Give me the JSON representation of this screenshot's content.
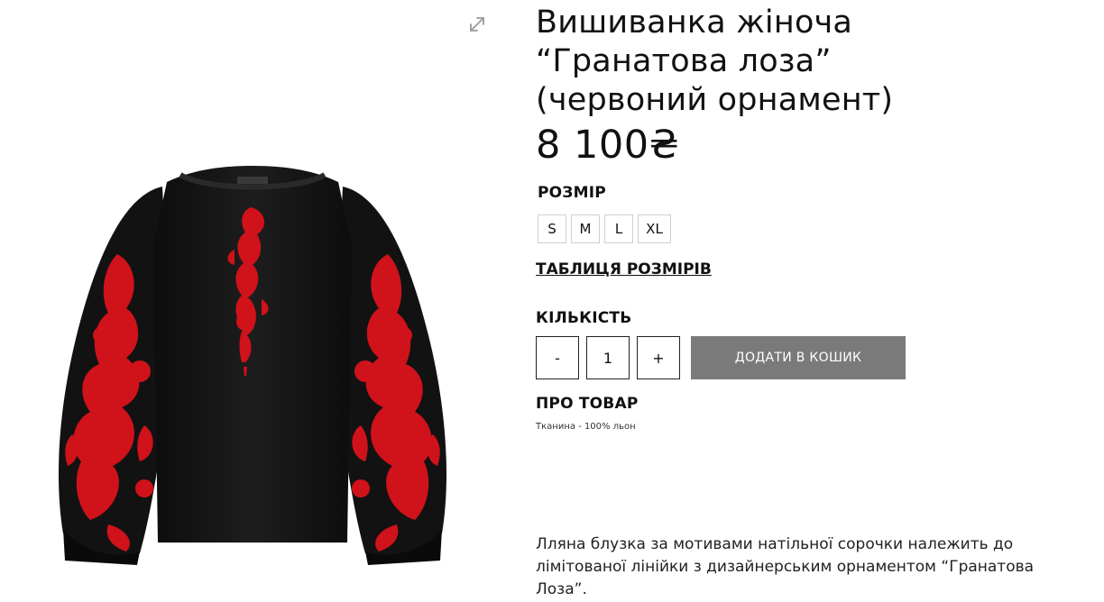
{
  "product": {
    "title": "Вишиванка жіноча\n“Гранатова лоза”\n(червоний орнамент)",
    "price": "8 100₴",
    "image_icon": "expand-icon",
    "image_alt": "black-linen-blouse-with-red-embroidery"
  },
  "size": {
    "label": "РОЗМІР",
    "options": [
      "S",
      "M",
      "L",
      "XL"
    ],
    "chart_link": "ТАБЛИЦЯ РОЗМІРІВ"
  },
  "quantity": {
    "label": "КІЛЬКІСТЬ",
    "minus": "-",
    "value": "1",
    "plus": "+"
  },
  "cart": {
    "add_label": "ДОДАТИ В КОШИК",
    "button_color": "#7a7a7a"
  },
  "about": {
    "label": "ПРО ТОВАР",
    "fabric": "Тканина - 100% льон",
    "description": "Лляна блузка за мотивами натільної сорочки належить до лімітованої лінійки з дизайнерським орнаментом “Гранатова Лоза”."
  },
  "colors": {
    "embroidery": "#d0121b",
    "blouse": "#141414"
  }
}
